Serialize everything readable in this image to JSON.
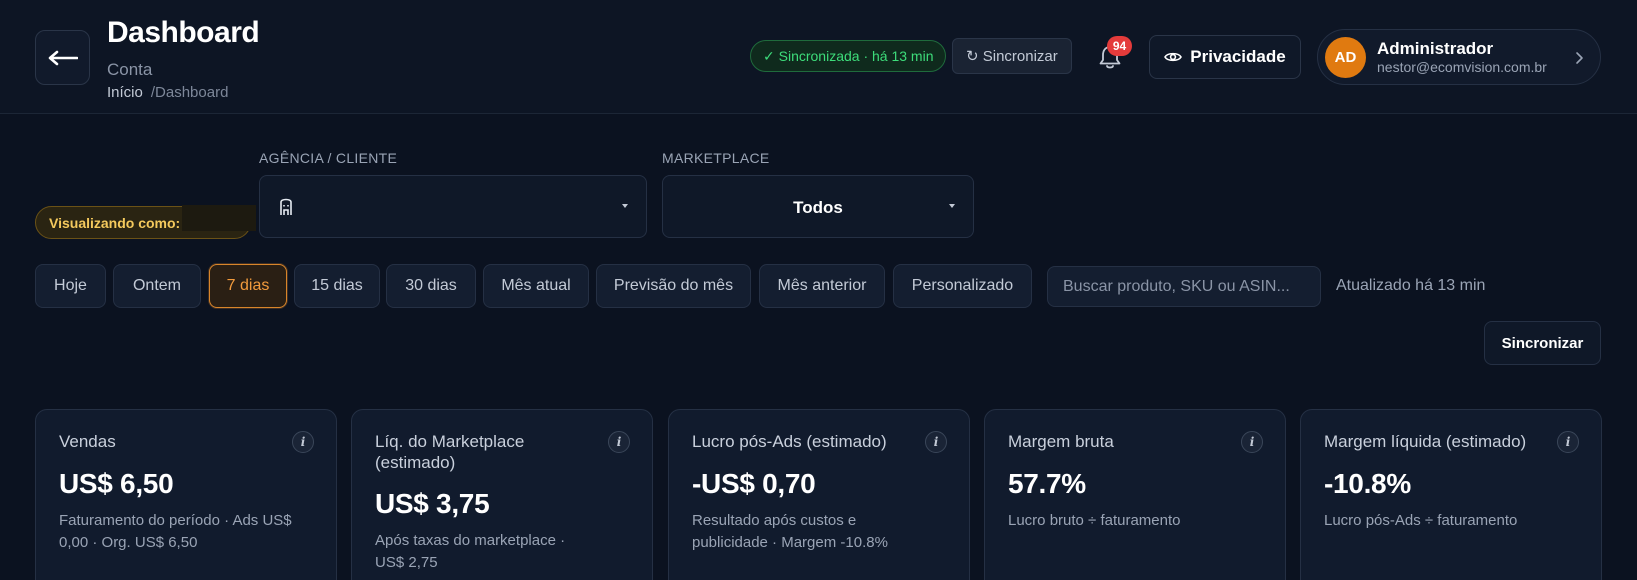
{
  "header": {
    "title": "Dashboard",
    "subtitle": "Conta",
    "breadcrumb": {
      "home": "Início",
      "current": "/Dashboard"
    },
    "sync_status": "✓ Sincronizada · há 13 min",
    "sync_button": "↻ Sincronizar",
    "notifications_count": "94",
    "privacy_button": "Privacidade",
    "user": {
      "initials": "AD",
      "name": "Administrador",
      "email": "nestor@ecomvision.com.br"
    }
  },
  "filters": {
    "viewing_as": "Visualizando como:",
    "agency_label": "AGÊNCIA / CLIENTE",
    "agency_value": "",
    "marketplace_label": "MARKETPLACE",
    "marketplace_value": "Todos",
    "periods": [
      "Hoje",
      "Ontem",
      "7 dias",
      "15 dias",
      "30 dias",
      "Mês atual",
      "Previsão do mês",
      "Mês anterior",
      "Personalizado"
    ],
    "active_period": "7 dias",
    "search_placeholder": "Buscar produto, SKU ou ASIN...",
    "updated_text": "Atualizado há 13 min",
    "sync_button": "Sincronizar"
  },
  "kpis": [
    {
      "title": "Vendas",
      "value": "US$ 6,50",
      "desc": "Faturamento do período · Ads US$ 0,00 · Org. US$ 6,50"
    },
    {
      "title": "Líq. do Marketplace (estimado)",
      "value": "US$ 3,75",
      "desc": "Após taxas do marketplace · US$ 2,75"
    },
    {
      "title": "Lucro pós-Ads (estimado)",
      "value": "-US$ 0,70",
      "desc": "Resultado após custos e publicidade · Margem -10.8%"
    },
    {
      "title": "Margem bruta",
      "value": "57.7%",
      "desc": "Lucro bruto ÷ faturamento"
    },
    {
      "title": "Margem líquida (estimado)",
      "value": "-10.8%",
      "desc": "Lucro pós-Ads ÷ faturamento"
    }
  ],
  "colors": {
    "background": "#0b1220",
    "accent_orange": "#f29b3d",
    "success_green": "#3ddc7a",
    "badge_red": "#e43b3b",
    "avatar_orange": "#e07a10"
  },
  "icons": [
    "back-arrow-icon",
    "bell-icon",
    "eye-icon",
    "chevron-right-icon",
    "building-icon",
    "info-icon",
    "caret-down-icon"
  ]
}
